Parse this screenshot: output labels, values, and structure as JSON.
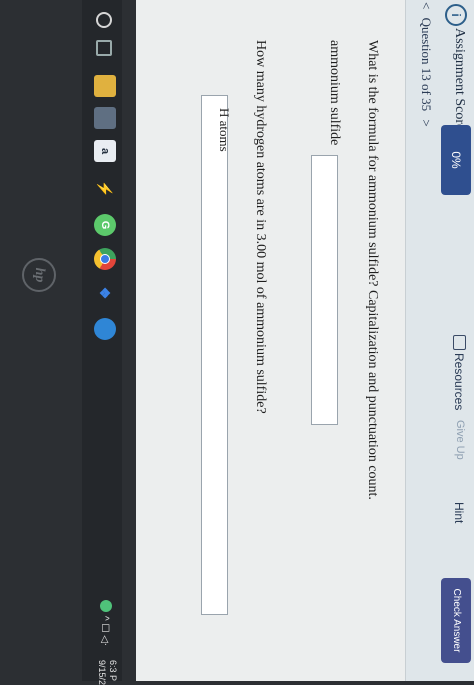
{
  "header": {
    "info_icon_glyph": "i",
    "score_label": "Assignment Score:",
    "score_value": "0%",
    "resources_label": "Resources",
    "give_up_label": "Give Up",
    "hint_label": "Hint",
    "check_answer_label": "Check Answer"
  },
  "question_nav": {
    "prev_glyph": "<",
    "label": "Question 13 of 35",
    "next_glyph": ">"
  },
  "question1": {
    "text": "What is the formula for ammonium sulfide? Capitalization and punctuation count.",
    "field_label": "ammonium sulfide",
    "field_value": ""
  },
  "question2": {
    "text": "How many hydrogen atoms are in 3.00 mol of ammonium sulfide?",
    "field_label": "H atoms",
    "field_value": ""
  },
  "taskbar": {
    "amazon_glyph": "a",
    "g_glyph": "G",
    "bolt_glyph": "⚡",
    "dropbox_glyph": "❖",
    "tray_text": "^ ☐ ◁ᐧ",
    "clock_time": "6:3 P",
    "clock_date": "9/15/2"
  },
  "brand": {
    "logo_text": "hp"
  },
  "colors": {
    "score_pill": "#2f4f8f",
    "check_answer": "#444f8e",
    "page_bg": "#eceeee",
    "header_bg": "#dfe6ea"
  }
}
